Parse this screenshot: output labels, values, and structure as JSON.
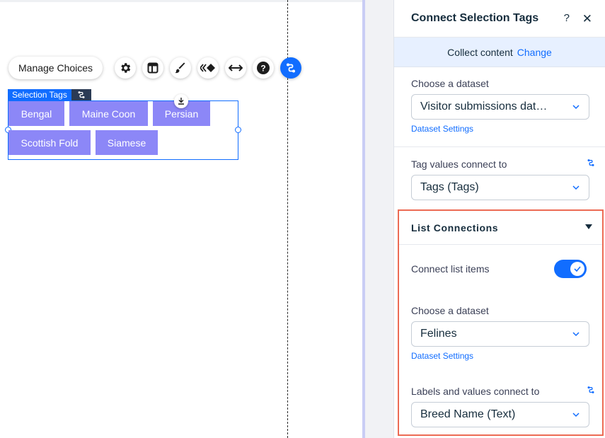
{
  "canvas": {
    "toolbar": {
      "manage_label": "Manage Choices",
      "icons": [
        "gear-icon",
        "layout-icon",
        "paint-brush-icon",
        "animation-icon",
        "stretch-icon",
        "help-icon",
        "connect-data-icon"
      ]
    },
    "element_label": "Selection Tags",
    "tags": [
      "Bengal",
      "Maine Coon",
      "Persian",
      "Scottish Fold",
      "Siamese"
    ]
  },
  "panel": {
    "title": "Connect Selection Tags",
    "help": "?",
    "close": "✕",
    "collect": {
      "text": "Collect content",
      "link": "Change"
    },
    "dataset": {
      "label": "Choose a dataset",
      "value": "Visitor submissions dat…",
      "settings_link": "Dataset Settings"
    },
    "tag_values": {
      "label": "Tag values connect to",
      "value": "Tags (Tags)"
    },
    "list_connections": {
      "title": "List Connections",
      "connect_items_label": "Connect list items",
      "connect_items_on": true,
      "dataset_label": "Choose a dataset",
      "dataset_value": "Felines",
      "settings_link": "Dataset Settings",
      "labels_label": "Labels and values connect to",
      "labels_value": "Breed Name (Text)"
    }
  },
  "colors": {
    "accent": "#116dff",
    "tag_fill": "#8c87f7",
    "highlight_border": "#ec6b54",
    "collect_bar": "#e7f0ff"
  }
}
